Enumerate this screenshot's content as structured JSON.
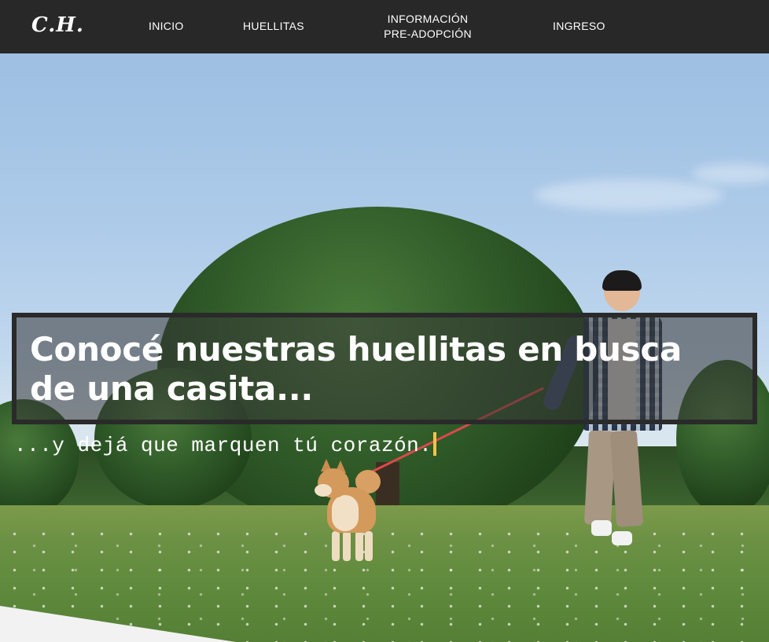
{
  "nav": {
    "logo": "C.H.",
    "links": {
      "inicio": "INICIO",
      "huellitas": "HUELLITAS",
      "info_line1": "INFORMACIÓN",
      "info_line2": "PRE-ADOPCIÓN",
      "ingreso": "INGRESO"
    }
  },
  "hero": {
    "headline": "Conocé nuestras huellitas en busca de una casita...",
    "subline": "...y dejá que marquen tú corazón."
  },
  "colors": {
    "navbar": "#282828",
    "cursor": "#f5c24a",
    "text": "#ffffff"
  }
}
